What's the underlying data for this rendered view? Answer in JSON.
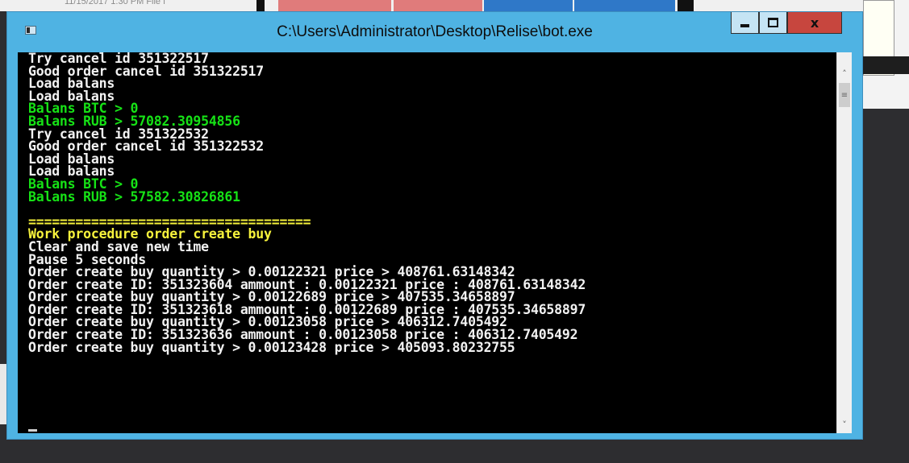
{
  "background": {
    "file_header_text": "11/15/2017 1:30 PM   File f"
  },
  "window": {
    "title": "C:\\Users\\Administrator\\Desktop\\Relise\\bot.exe",
    "icon": "console-app-icon",
    "controls": {
      "minimize_icon": "minimize-icon",
      "maximize_icon": "maximize-icon",
      "close_label": "x"
    },
    "accent_color": "#4fb3e3",
    "close_color": "#c7463e"
  },
  "console": {
    "lines": [
      {
        "text": "Try cancel id 351322517",
        "color": "white"
      },
      {
        "text": "Good order cancel id 351322517",
        "color": "white"
      },
      {
        "text": "Load balans",
        "color": "white"
      },
      {
        "text": "Load balans",
        "color": "white"
      },
      {
        "text": "Balans BTC > 0",
        "color": "green"
      },
      {
        "text": "Balans RUB > 57082.30954856",
        "color": "green"
      },
      {
        "text": "Try cancel id 351322532",
        "color": "white"
      },
      {
        "text": "Good order cancel id 351322532",
        "color": "white"
      },
      {
        "text": "Load balans",
        "color": "white"
      },
      {
        "text": "Load balans",
        "color": "white"
      },
      {
        "text": "Balans BTC > 0",
        "color": "green"
      },
      {
        "text": "Balans RUB > 57582.30826861",
        "color": "green"
      },
      {
        "text": "",
        "color": "white"
      },
      {
        "text": "====================================",
        "color": "yellow"
      },
      {
        "text": "Work procedure order create buy",
        "color": "yellow"
      },
      {
        "text": "Clear and save new time",
        "color": "white"
      },
      {
        "text": "Pause 5 seconds",
        "color": "white"
      },
      {
        "text": "Order create buy quantity > 0.00122321 price > 408761.63148342",
        "color": "white"
      },
      {
        "text": "Order create ID: 351323604 ammount : 0.00122321 price : 408761.63148342",
        "color": "white"
      },
      {
        "text": "Order create buy quantity > 0.00122689 price > 407535.34658897",
        "color": "white"
      },
      {
        "text": "Order create ID: 351323618 ammount : 0.00122689 price : 407535.34658897",
        "color": "white"
      },
      {
        "text": "Order create buy quantity > 0.00123058 price > 406312.7405492",
        "color": "white"
      },
      {
        "text": "Order create ID: 351323636 ammount : 0.00123058 price : 406312.7405492",
        "color": "white"
      },
      {
        "text": "Order create buy quantity > 0.00123428 price > 405093.80232755",
        "color": "white"
      }
    ],
    "colors": {
      "white": "#f2f2f2",
      "green": "#16e216",
      "yellow": "#f7f33c",
      "background": "#000000"
    }
  },
  "scrollbar": {
    "up_icon": "chevron-up-icon",
    "down_icon": "chevron-down-icon",
    "thumb_icon": "grip-icon"
  }
}
